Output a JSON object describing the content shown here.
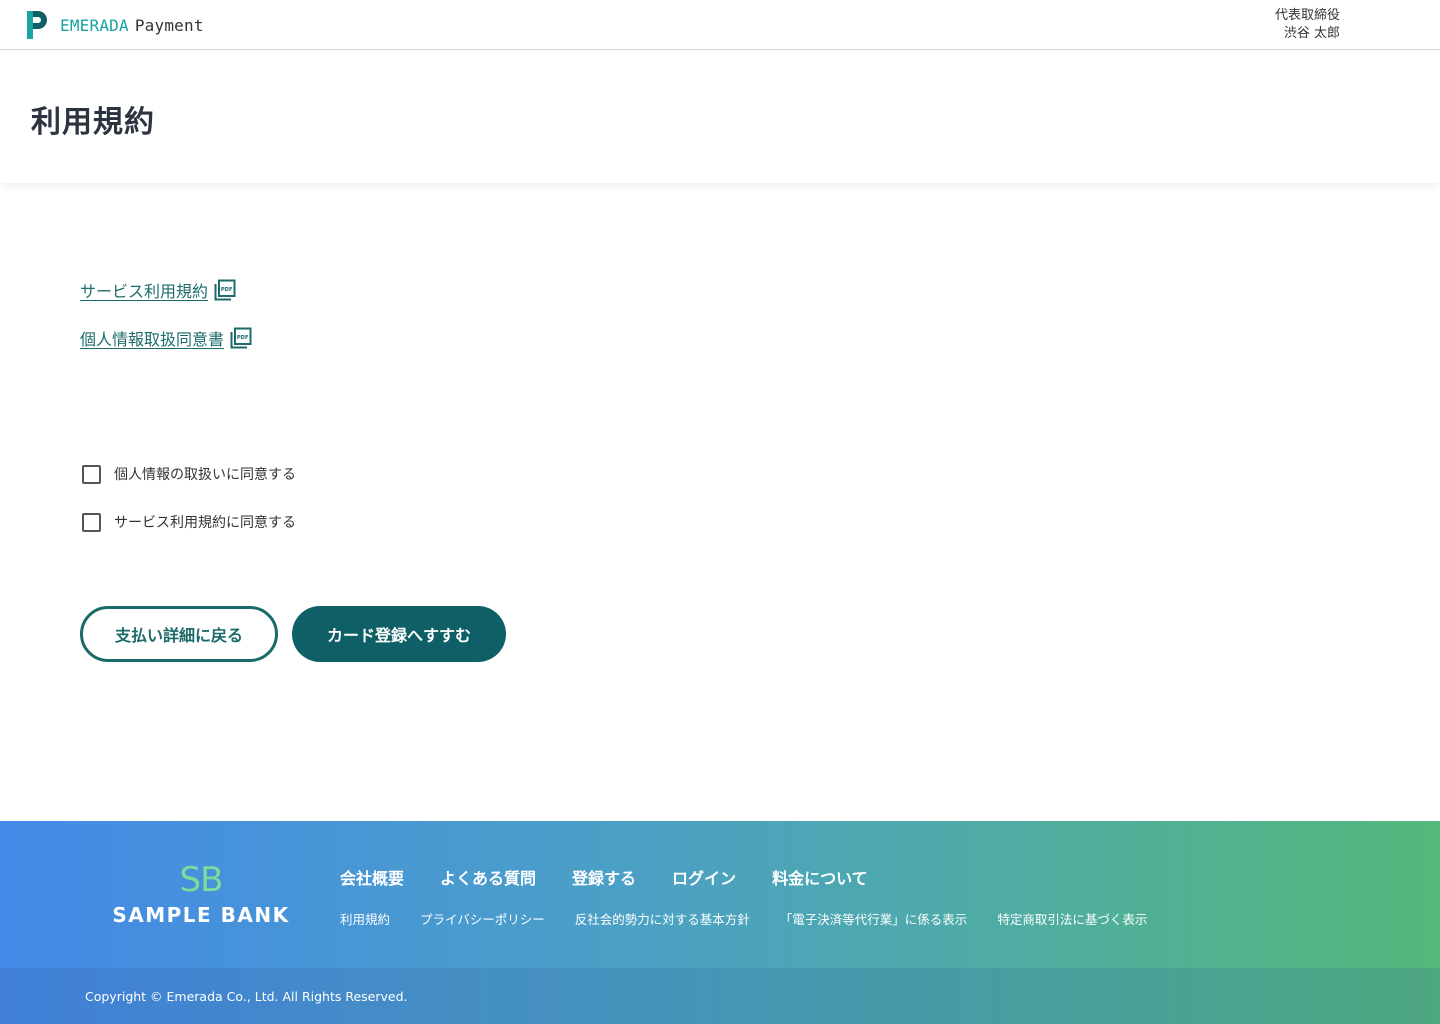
{
  "header": {
    "brand": "EMERADA",
    "product": "Payment",
    "user_role": "代表取締役",
    "user_name": "渋谷 太郎"
  },
  "page": {
    "title": "利用規約"
  },
  "documents": [
    {
      "label": "サービス利用規約",
      "icon": "pdf-icon"
    },
    {
      "label": "個人情報取扱同意書",
      "icon": "pdf-icon"
    }
  ],
  "agreements": [
    {
      "label": "個人情報の取扱いに同意する",
      "checked": false
    },
    {
      "label": "サービス利用規約に同意する",
      "checked": false
    }
  ],
  "buttons": {
    "back": "支払い詳細に戻る",
    "next": "カード登録へすすむ"
  },
  "footer": {
    "logo_mark": "SB",
    "logo_name": "SAMPLE BANK",
    "nav": [
      "会社概要",
      "よくある質問",
      "登録する",
      "ログイン",
      "料金について"
    ],
    "sub_links": [
      "利用規約",
      "プライバシーポリシー",
      "反社会的勢力に対する基本方針",
      "「電子決済等代行業」に係る表示",
      "特定商取引法に基づく表示"
    ],
    "copyright": "Copyright © Emerada Co., Ltd. All Rights Reserved."
  },
  "colors": {
    "accent": "#0e5f66",
    "link": "#1e6b6b",
    "brand_teal": "#1aa3a3",
    "footer_start": "#4489e8",
    "footer_end": "#53b97b"
  }
}
